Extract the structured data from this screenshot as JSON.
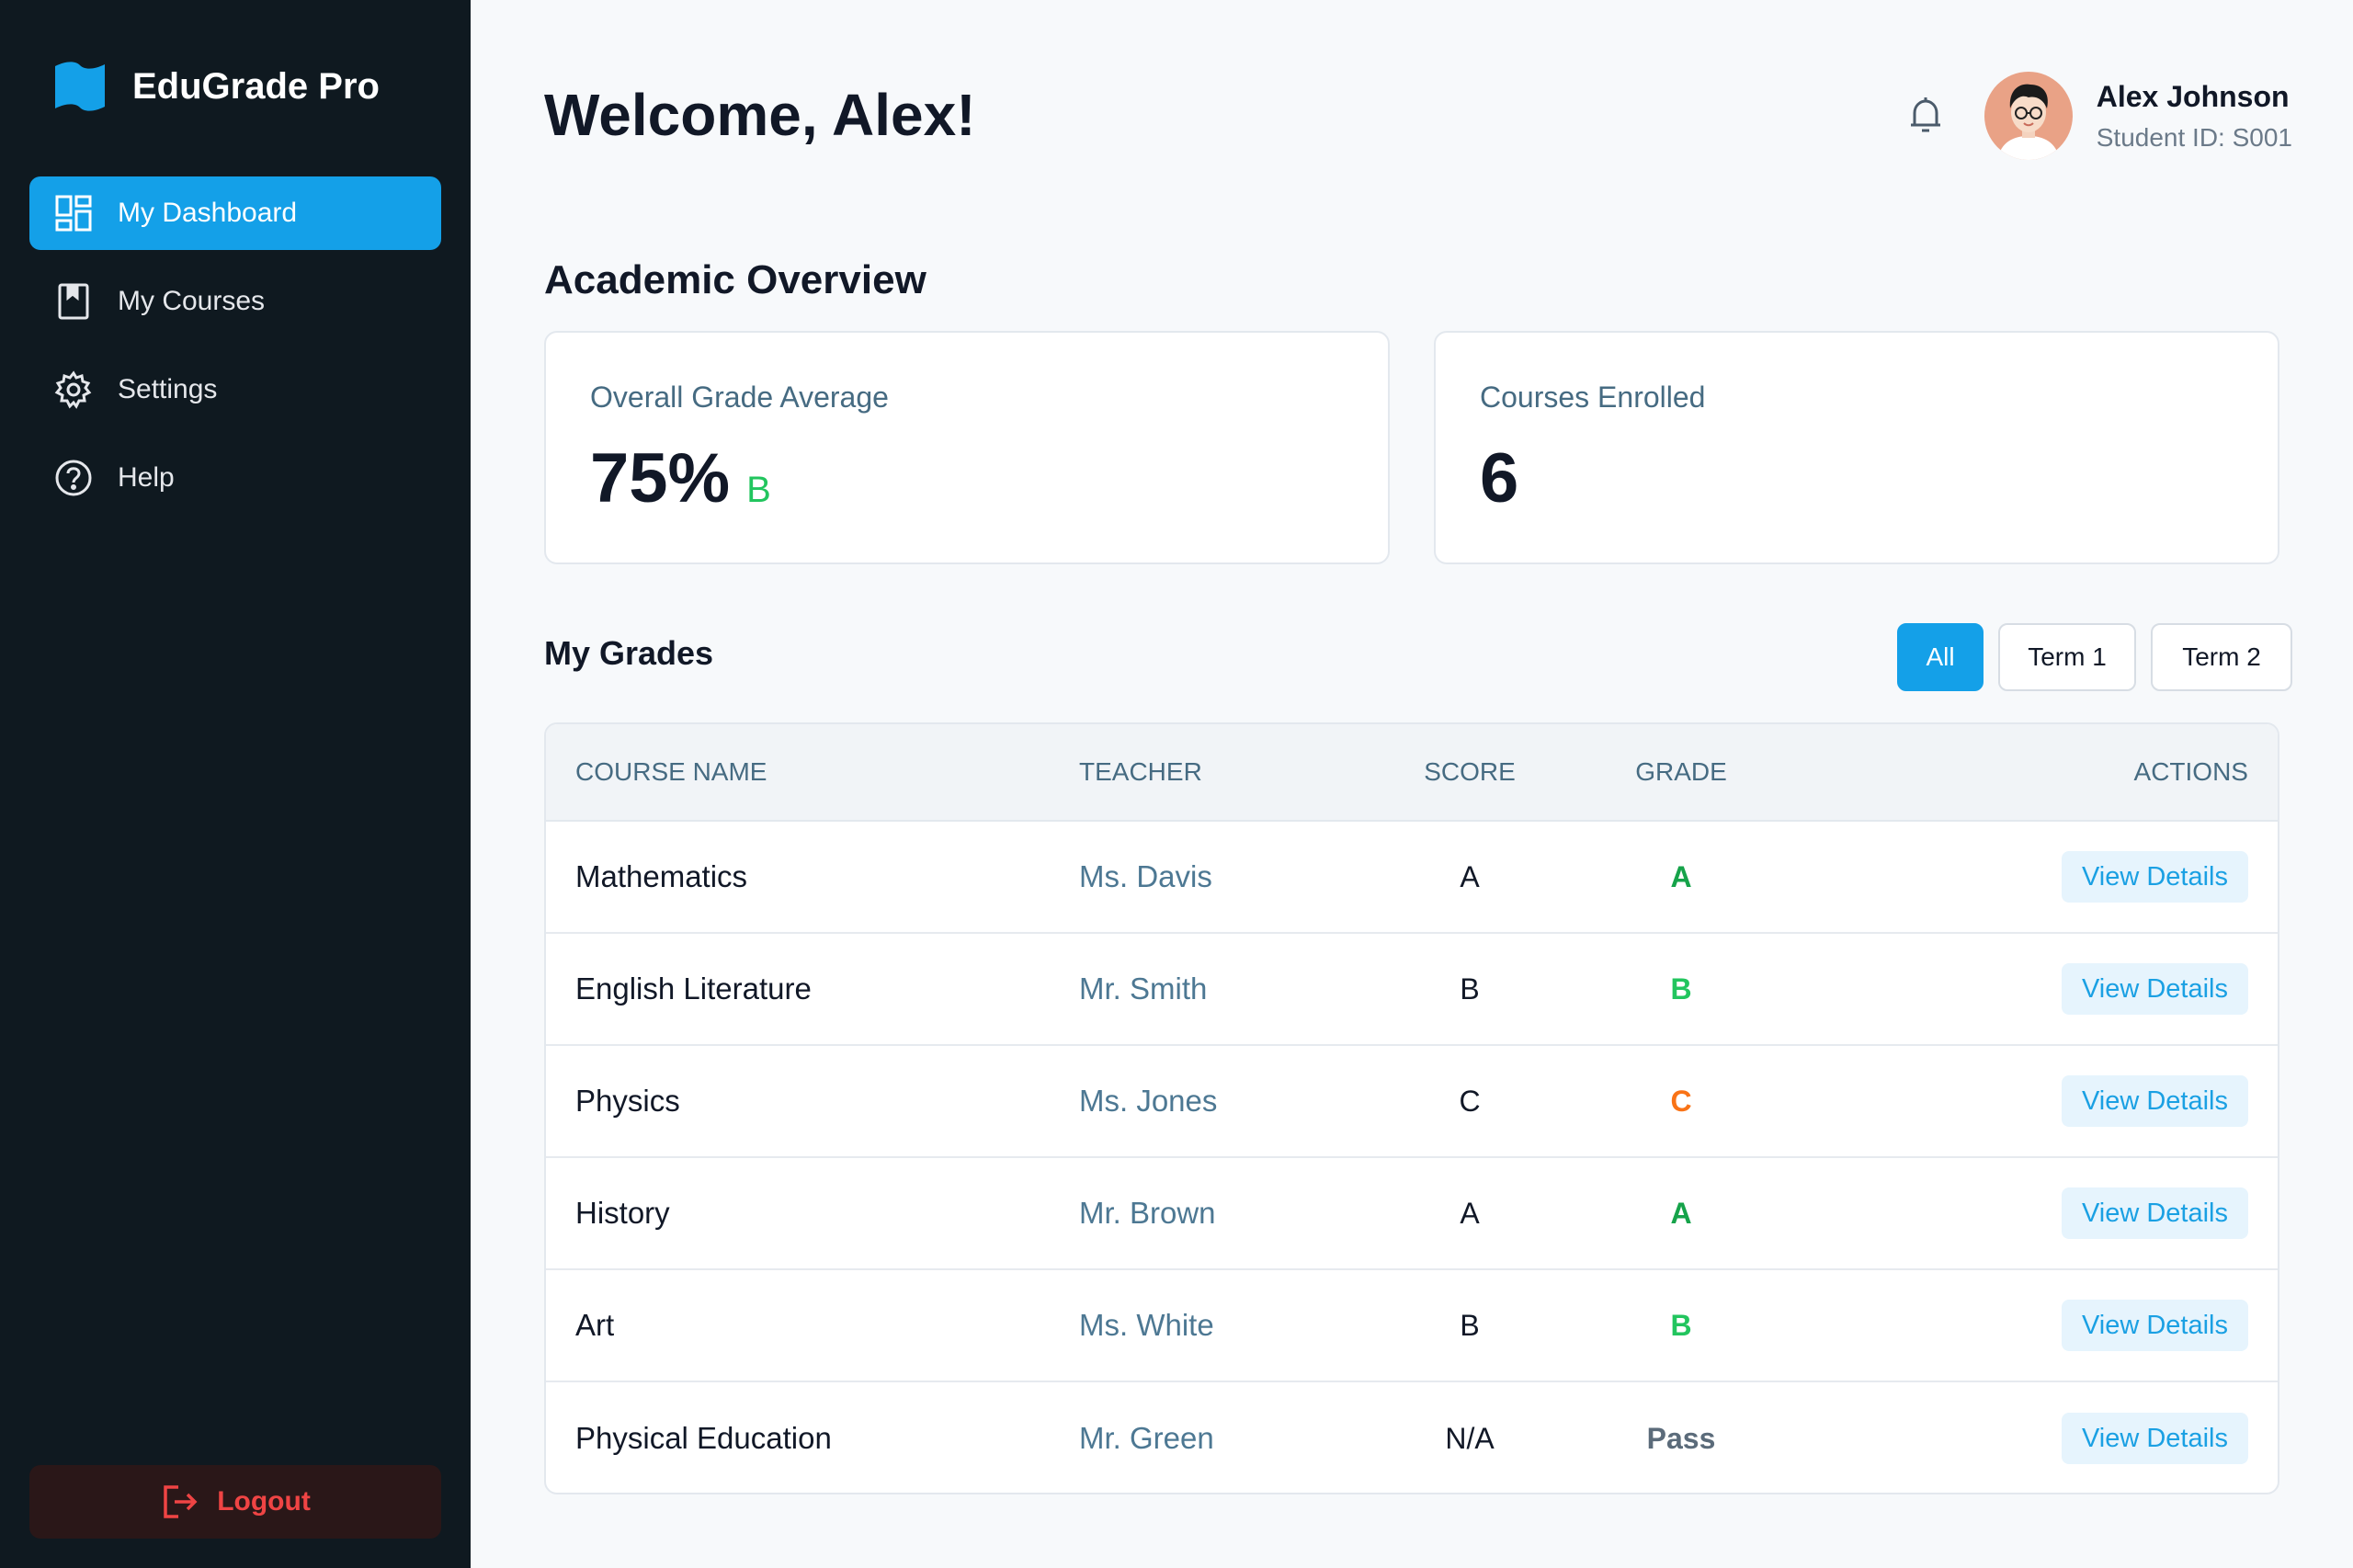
{
  "app": {
    "name": "EduGrade Pro"
  },
  "sidebar": {
    "items": [
      {
        "label": "My Dashboard",
        "icon": "dashboard-icon",
        "active": true
      },
      {
        "label": "My Courses",
        "icon": "book-icon",
        "active": false
      },
      {
        "label": "Settings",
        "icon": "gear-icon",
        "active": false
      },
      {
        "label": "Help",
        "icon": "help-circle-icon",
        "active": false
      }
    ],
    "logout_label": "Logout"
  },
  "header": {
    "welcome": "Welcome, Alex!",
    "user_name": "Alex Johnson",
    "student_id": "Student ID: S001"
  },
  "overview": {
    "title": "Academic Overview",
    "grade_avg_label": "Overall Grade Average",
    "grade_avg_value": "75%",
    "grade_avg_letter": "B",
    "courses_label": "Courses Enrolled",
    "courses_value": "6"
  },
  "grades": {
    "title": "My Grades",
    "filters": [
      "All",
      "Term 1",
      "Term 2"
    ],
    "active_filter": "All",
    "columns": [
      "COURSE NAME",
      "TEACHER",
      "SCORE",
      "GRADE",
      "ACTIONS"
    ],
    "action_label": "View Details",
    "rows": [
      {
        "course": "Mathematics",
        "teacher": "Ms. Davis",
        "score": "A",
        "grade": "A",
        "grade_color": "#16a34a"
      },
      {
        "course": "English Literature",
        "teacher": "Mr. Smith",
        "score": "B",
        "grade": "B",
        "grade_color": "#22c55e"
      },
      {
        "course": "Physics",
        "teacher": "Ms. Jones",
        "score": "C",
        "grade": "C",
        "grade_color": "#f97316"
      },
      {
        "course": "History",
        "teacher": "Mr. Brown",
        "score": "A",
        "grade": "A",
        "grade_color": "#16a34a"
      },
      {
        "course": "Art",
        "teacher": "Ms. White",
        "score": "B",
        "grade": "B",
        "grade_color": "#22c55e"
      },
      {
        "course": "Physical Education",
        "teacher": "Mr. Green",
        "score": "N/A",
        "grade": "Pass",
        "grade_color": "#5b6b7a"
      }
    ]
  },
  "colors": {
    "accent": "#14a0e8",
    "sidebar_bg": "#0f1920",
    "logout_red": "#ef4444"
  }
}
